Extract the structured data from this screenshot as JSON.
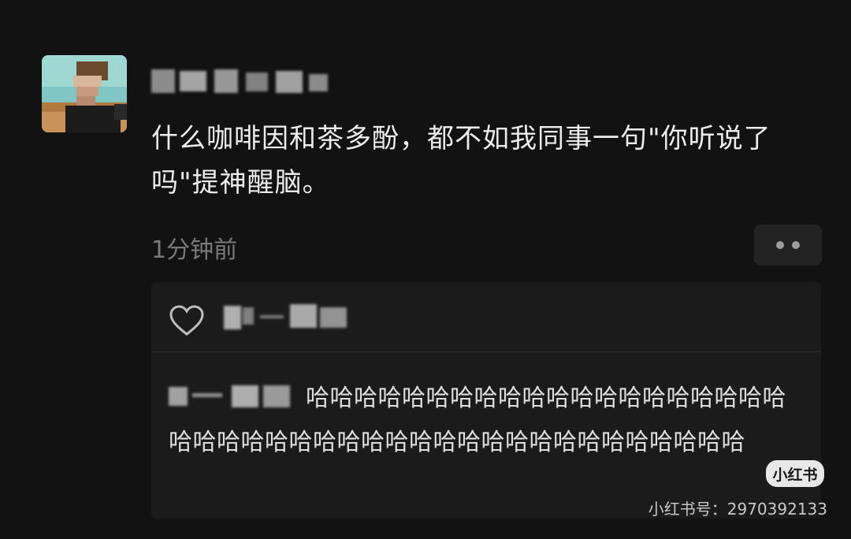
{
  "post": {
    "text": "什么咖啡因和茶多酚，都不如我同事一句\"你听说了吗\"提神醒脑。",
    "timestamp": "1分钟前"
  },
  "comment": {
    "text": "哈哈哈哈哈哈哈哈哈哈哈哈哈哈哈哈哈哈哈哈哈哈哈哈哈哈哈哈哈哈哈哈哈哈哈哈哈哈哈哈哈哈哈哈"
  },
  "watermark": {
    "badge": "小红书",
    "id_text": "小红书号：2970392133"
  },
  "icons": {
    "like": "heart-outline-icon",
    "more": "more-dots-icon"
  },
  "colors": {
    "background": "#121212",
    "panel": "#1b1b1b",
    "muted_text": "#7a7a7a"
  }
}
